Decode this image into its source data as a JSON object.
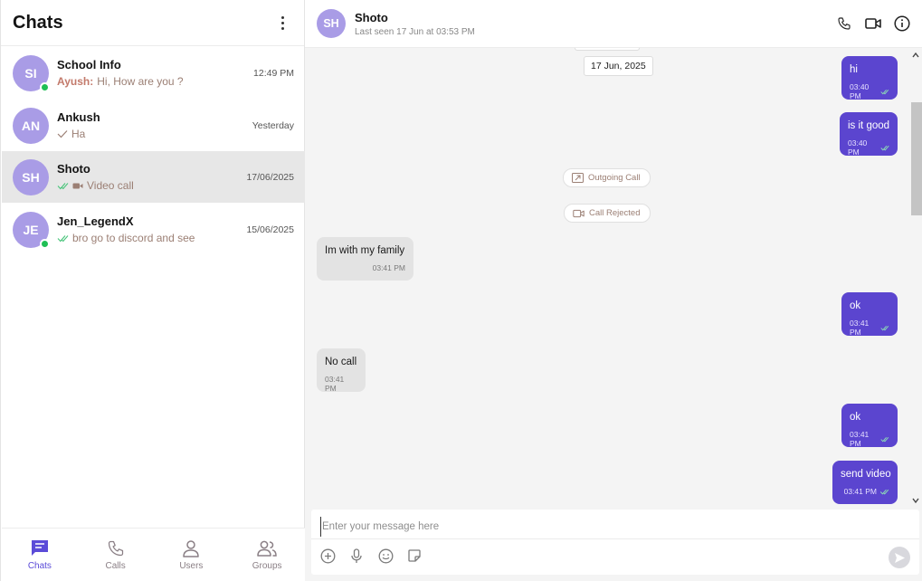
{
  "sidebar": {
    "title": "Chats",
    "chats": [
      {
        "initials": "SI",
        "name": "School Info",
        "sender": "Ayush:",
        "preview": "Hi, How are you ?",
        "time": "12:49 PM",
        "online": true,
        "tick": "none",
        "icon": "none"
      },
      {
        "initials": "AN",
        "name": "Ankush",
        "sender": "",
        "preview": "Ha",
        "time": "Yesterday",
        "online": false,
        "tick": "single-check-icon",
        "icon": "none"
      },
      {
        "initials": "SH",
        "name": "Shoto",
        "sender": "",
        "preview": "Video call",
        "time": "17/06/2025",
        "online": false,
        "tick": "double-check-icon",
        "icon": "video-call-icon",
        "active": true
      },
      {
        "initials": "JE",
        "name": "Jen_LegendX",
        "sender": "",
        "preview": "bro go to discord and see",
        "time": "15/06/2025",
        "online": true,
        "tick": "double-check-icon",
        "icon": "none"
      }
    ],
    "nav": [
      {
        "label": "Chats",
        "icon": "chat-bubble-icon",
        "active": true
      },
      {
        "label": "Calls",
        "icon": "phone-icon",
        "active": false
      },
      {
        "label": "Users",
        "icon": "user-icon",
        "active": false
      },
      {
        "label": "Groups",
        "icon": "group-icon",
        "active": false
      }
    ]
  },
  "chat": {
    "contact_initials": "SH",
    "contact_name": "Shoto",
    "status": "Last seen 17 Jun at 03:53 PM",
    "date_divider": "17 Jun, 2025",
    "messages": [
      {
        "dir": "out",
        "text": "hi",
        "time": "03:40 PM"
      },
      {
        "dir": "out",
        "text": "is it good",
        "time": "03:40 PM"
      },
      {
        "dir": "call",
        "text": "Outgoing Call",
        "icon": "outgoing-call-icon"
      },
      {
        "dir": "call",
        "text": "Call Rejected",
        "icon": "video-camera-icon"
      },
      {
        "dir": "in",
        "text": "Im with my family",
        "time": "03:41 PM"
      },
      {
        "dir": "out",
        "text": "ok",
        "time": "03:41 PM"
      },
      {
        "dir": "in",
        "text": "No call",
        "time": "03:41 PM"
      },
      {
        "dir": "out",
        "text": "ok",
        "time": "03:41 PM"
      },
      {
        "dir": "out",
        "text": "send video",
        "time": "03:41 PM"
      }
    ],
    "composer_placeholder": "Enter your message here"
  },
  "colors": {
    "accent": "#5b45cf",
    "avatar": "#a99ce6",
    "online": "#1fbf55",
    "preview_text": "#9b7f74"
  }
}
